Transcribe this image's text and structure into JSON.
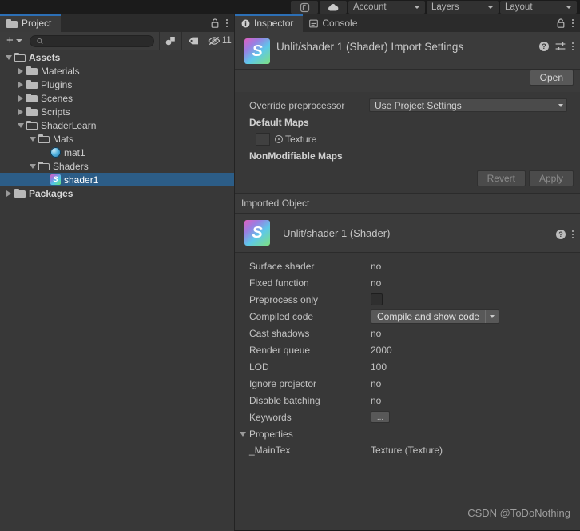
{
  "top_toolbar": {
    "icon_buttons": [
      {
        "name": "collab-icon",
        "glyph": "Ⓟ"
      },
      {
        "name": "cloud-icon",
        "glyph": "☁"
      }
    ],
    "dropdowns": [
      {
        "label": "Account"
      },
      {
        "label": "Layers"
      },
      {
        "label": "Layout"
      }
    ]
  },
  "project_panel": {
    "tab": {
      "label": "Project",
      "icon": "folder-icon",
      "active": true
    },
    "lock_icon": "lock-icon",
    "menu_icon": "kebab-menu-icon",
    "toolbar": {
      "add_label": "+",
      "search_placeholder": "",
      "search_value": "",
      "search_icon": "search-icon",
      "filter_icon": "filter-by-type-icon",
      "label_icon": "filter-by-label-icon",
      "visibility_icon": "hidden-objects-icon",
      "visibility_count": "11"
    },
    "tree": [
      {
        "label": "Assets",
        "depth": 0,
        "state": "open",
        "icon": "folder-open-icon",
        "bold": true,
        "selected": false
      },
      {
        "label": "Materials",
        "depth": 1,
        "state": "closed",
        "icon": "folder-icon",
        "bold": false,
        "selected": false
      },
      {
        "label": "Plugins",
        "depth": 1,
        "state": "closed",
        "icon": "folder-icon",
        "bold": false,
        "selected": false
      },
      {
        "label": "Scenes",
        "depth": 1,
        "state": "closed",
        "icon": "folder-icon",
        "bold": false,
        "selected": false
      },
      {
        "label": "Scripts",
        "depth": 1,
        "state": "closed",
        "icon": "folder-icon",
        "bold": false,
        "selected": false
      },
      {
        "label": "ShaderLearn",
        "depth": 1,
        "state": "open",
        "icon": "folder-open-icon",
        "bold": false,
        "selected": false
      },
      {
        "label": "Mats",
        "depth": 2,
        "state": "open",
        "icon": "folder-open-icon",
        "bold": false,
        "selected": false
      },
      {
        "label": "mat1",
        "depth": 3,
        "state": "leaf",
        "icon": "material-icon",
        "bold": false,
        "selected": false
      },
      {
        "label": "Shaders",
        "depth": 2,
        "state": "open",
        "icon": "folder-open-icon",
        "bold": false,
        "selected": false
      },
      {
        "label": "shader1",
        "depth": 3,
        "state": "leaf",
        "icon": "shader-icon",
        "bold": false,
        "selected": true
      },
      {
        "label": "Packages",
        "depth": 0,
        "state": "closed",
        "icon": "folder-icon",
        "bold": true,
        "selected": false
      }
    ]
  },
  "inspector_panel": {
    "tabs": [
      {
        "label": "Inspector",
        "icon": "info-icon",
        "active": true
      },
      {
        "label": "Console",
        "icon": "console-icon",
        "active": false
      }
    ],
    "lock_icon": "lock-icon",
    "menu_icon": "kebab-menu-icon",
    "import_settings": {
      "title": "Unlit/shader 1 (Shader) Import Settings",
      "icon": "shader-asset-icon",
      "icon_letter": "S",
      "help_icon": "help-icon",
      "preset_icon": "preset-icon",
      "menu_icon": "kebab-menu-icon",
      "open_button": "Open",
      "override_preprocessor_label": "Override preprocessor",
      "override_preprocessor_value": "Use Project Settings",
      "default_maps_label": "Default Maps",
      "texture_label": "Texture",
      "nonmodifiable_maps_label": "NonModifiable Maps",
      "revert_button": "Revert",
      "apply_button": "Apply"
    },
    "imported_object": {
      "section_label": "Imported Object",
      "title": "Unlit/shader 1 (Shader)",
      "icon": "shader-asset-icon",
      "icon_letter": "S",
      "help_icon": "help-icon",
      "menu_icon": "kebab-menu-icon",
      "properties": [
        {
          "label": "Surface shader",
          "value": "no",
          "type": "text"
        },
        {
          "label": "Fixed function",
          "value": "no",
          "type": "text"
        },
        {
          "label": "Preprocess only",
          "value": "",
          "type": "checkbox",
          "checked": false
        },
        {
          "label": "Compiled code",
          "value": "Compile and show code",
          "type": "split-button"
        },
        {
          "label": "Cast shadows",
          "value": "no",
          "type": "text"
        },
        {
          "label": "Render queue",
          "value": "2000",
          "type": "text"
        },
        {
          "label": "LOD",
          "value": "100",
          "type": "text"
        },
        {
          "label": "Ignore projector",
          "value": "no",
          "type": "text"
        },
        {
          "label": "Disable batching",
          "value": "no",
          "type": "text"
        },
        {
          "label": "Keywords",
          "value": "...",
          "type": "dots-button"
        }
      ],
      "properties_foldout": {
        "label": "Properties",
        "expanded": true,
        "items": [
          {
            "label": "_MainTex",
            "value": "Texture (Texture)"
          }
        ]
      }
    }
  },
  "watermark": "CSDN @ToDoNothing",
  "colors": {
    "panel_bg": "#383838",
    "header_bg": "#3b3b3b",
    "tabbar_bg": "#2b2b2b",
    "toolbar_bg": "#1b1b1b",
    "selection_blue": "#2c5d87",
    "active_tab_underline": "#2c6fb5",
    "text": "#c4c4c4"
  }
}
